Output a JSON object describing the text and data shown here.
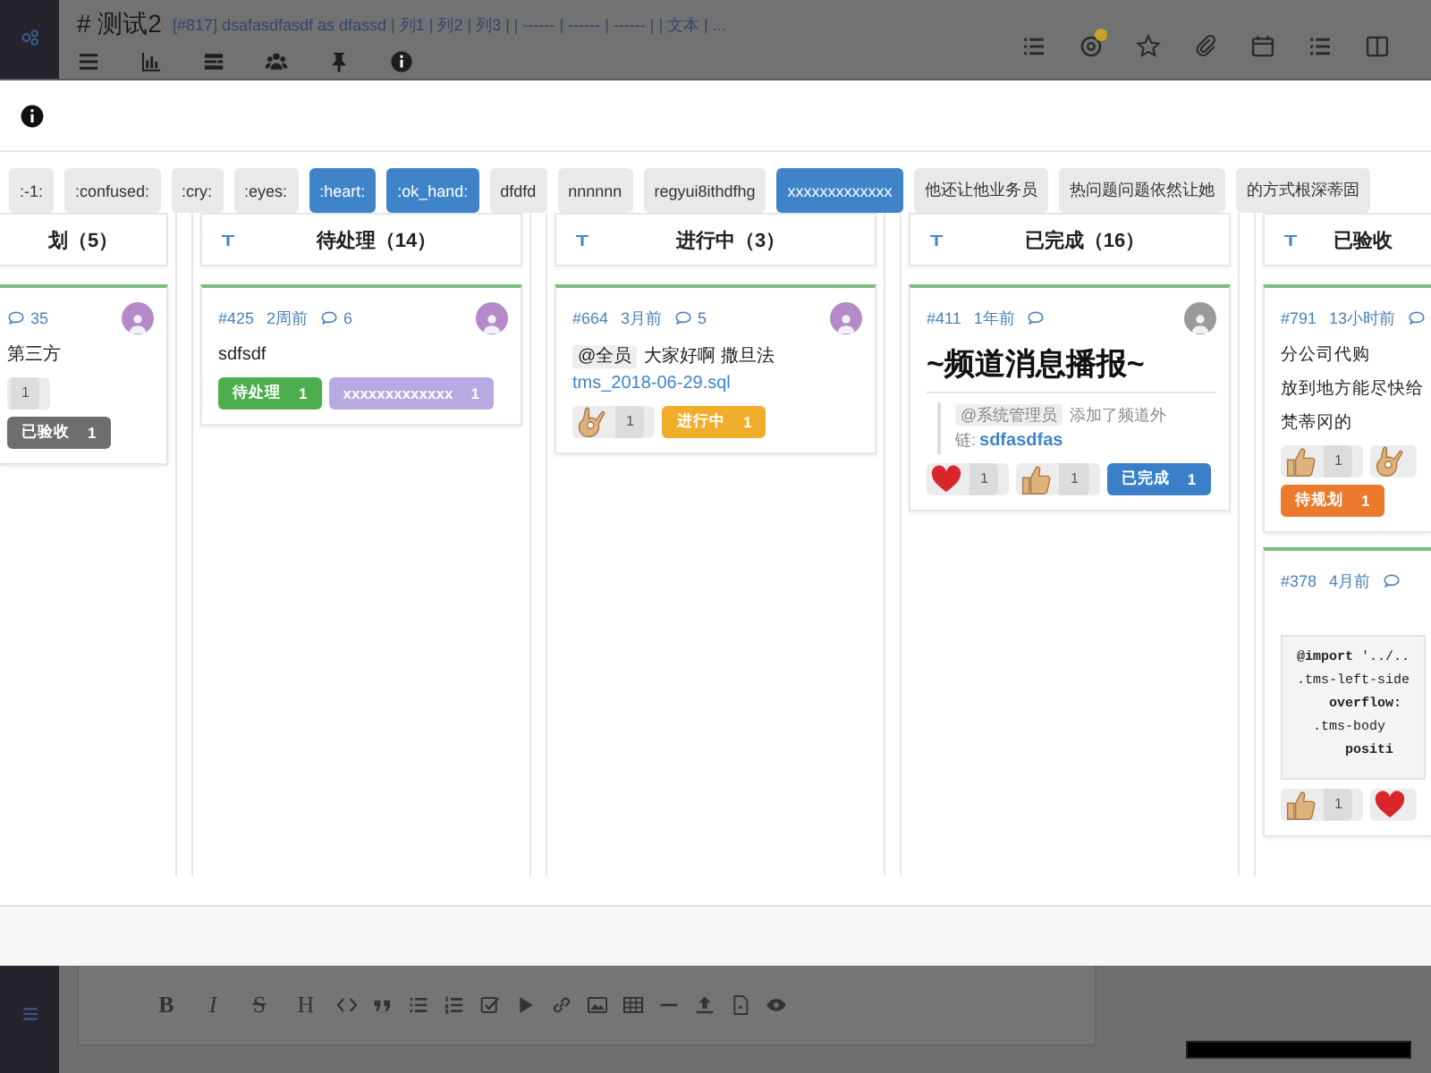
{
  "app_bar": {
    "title": "# 测试2",
    "subtitle": "[#817] dsafasdfasdf as dfassd | 列1 | 列2 | 列3 | | ------ | ------ | ------ | | 文本 | ...",
    "mentions_badge": true
  },
  "modal": {
    "tags": [
      {
        "label": ":-1:",
        "selected": false
      },
      {
        "label": ":confused:",
        "selected": false
      },
      {
        "label": ":cry:",
        "selected": false
      },
      {
        "label": ":eyes:",
        "selected": false
      },
      {
        "label": ":heart:",
        "selected": true
      },
      {
        "label": ":ok_hand:",
        "selected": true
      },
      {
        "label": "dfdfd",
        "selected": false
      },
      {
        "label": "nnnnnn",
        "selected": false
      },
      {
        "label": "regyui8ithdfhg",
        "selected": false
      },
      {
        "label": "xxxxxxxxxxxxx",
        "selected": true
      },
      {
        "label": "他还让他业务员",
        "selected": false
      },
      {
        "label": "热问题问题依然让她",
        "selected": false
      },
      {
        "label": "的方式根深蒂固",
        "selected": false
      }
    ],
    "columns": [
      {
        "kind": "cut_left",
        "title": "划（5）",
        "cards": [
          {
            "comments": "35",
            "avatar": {
              "color": "#b58ac8"
            },
            "body": [
              {
                "kind": "text",
                "text": "第三方"
              }
            ],
            "reactions": [
              {
                "kind": "cut",
                "count": "1"
              }
            ],
            "labels": [
              {
                "text": "已验收",
                "count": "1",
                "color": "#6e6e6e"
              }
            ]
          }
        ]
      },
      {
        "kind": "full",
        "title": "待处理（14）",
        "cards": [
          {
            "id": "#425",
            "time": "2周前",
            "comments": "6",
            "avatar": {
              "color": "#b58ac8"
            },
            "body": [
              {
                "kind": "text",
                "text": "sdfsdf"
              }
            ],
            "labels": [
              {
                "text": "待处理",
                "count": "1",
                "color": "#4cae4c"
              },
              {
                "text": "xxxxxxxxxxxxx",
                "count": "1",
                "color": "#b8a9e3"
              }
            ]
          }
        ]
      },
      {
        "kind": "full",
        "title": "进行中（3）",
        "cards": [
          {
            "id": "#664",
            "time": "3月前",
            "comments": "5",
            "avatar": {
              "color": "#b58ac8"
            },
            "body": [
              {
                "kind": "rich",
                "parts": [
                  {
                    "kind": "mention",
                    "text": "@全员"
                  },
                  {
                    "kind": "text",
                    "text": "大家好啊 撒旦法"
                  },
                  {
                    "kind": "link",
                    "text": "tms_2018-06-29.sql"
                  }
                ]
              }
            ],
            "reactions": [
              {
                "kind": "ok_hand",
                "count": "1"
              }
            ],
            "labels": [
              {
                "text": "进行中",
                "count": "1",
                "color": "#f0ad29"
              }
            ]
          }
        ]
      },
      {
        "kind": "full",
        "title": "已完成（16）",
        "cards": [
          {
            "id": "#411",
            "time": "1年前",
            "avatar": {
              "color": "#9a9a9a"
            },
            "body": [
              {
                "kind": "heading",
                "text": "~频道消息播报~"
              },
              {
                "kind": "quote",
                "parts": [
                  {
                    "kind": "mention",
                    "text": "@系统管理员"
                  },
                  {
                    "kind": "text",
                    "text": "添加了频道外链:"
                  },
                  {
                    "kind": "link",
                    "text": "sdfasdfas"
                  }
                ]
              }
            ],
            "reactions": [
              {
                "kind": "heart",
                "count": "1"
              },
              {
                "kind": "thumbs_up",
                "count": "1"
              }
            ],
            "labels": [
              {
                "text": "已完成",
                "count": "1",
                "color": "#3a80c8"
              }
            ]
          }
        ]
      },
      {
        "kind": "cut_right",
        "title": "已验收",
        "cards": [
          {
            "id": "#791",
            "time": "13小时前",
            "body": [
              {
                "kind": "text",
                "text": "分公司代购"
              },
              {
                "kind": "text",
                "text": "放到地方能尽快给"
              },
              {
                "kind": "text",
                "text": "梵蒂冈的"
              }
            ],
            "reactions": [
              {
                "kind": "thumbs_up",
                "count": "1"
              },
              {
                "kind": "ok_hand"
              }
            ],
            "labels": [
              {
                "text": "待规划",
                "count": "1",
                "color": "#ec7a2c"
              }
            ]
          },
          {
            "id": "#378",
            "time": "4月前",
            "body": [
              {
                "kind": "code",
                "lines": [
                  "**@import** '../..",
                  ".tms-left-side",
                  "    **overflow:**",
                  "  .tms-body",
                  "      **positi**"
                ]
              }
            ],
            "reactions": [
              {
                "kind": "thumbs_up",
                "count": "1"
              },
              {
                "kind": "heart"
              }
            ]
          }
        ]
      }
    ]
  },
  "editor": {
    "format_buttons": [
      "B",
      "I",
      "S",
      "H"
    ]
  }
}
